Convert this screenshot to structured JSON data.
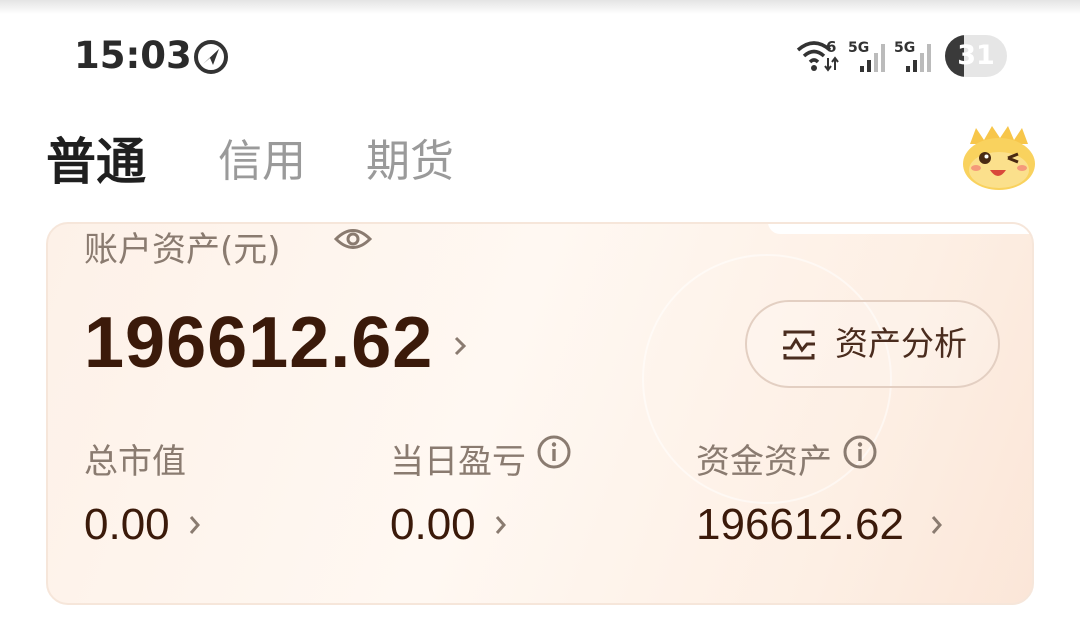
{
  "status_bar": {
    "time": "15:03",
    "wifi_label": "6",
    "signal_1_label": "5G",
    "signal_2_label": "5G",
    "battery": "31",
    "battery_level": 0.31
  },
  "tabs": [
    {
      "label": "普通",
      "active": true
    },
    {
      "label": "信用",
      "active": false
    },
    {
      "label": "期货",
      "active": false
    }
  ],
  "account": {
    "asset_label": "账户资产(元)",
    "total_assets": "196612.62",
    "analysis_button": "资产分析",
    "stats": [
      {
        "label": "总市值",
        "value": "0.00"
      },
      {
        "label": "当日盈亏",
        "value": "0.00"
      },
      {
        "label": "资金资产",
        "value": "196612.62"
      }
    ]
  },
  "colors": {
    "accent_text": "#3b1a0a",
    "muted_text": "#8a7b70",
    "card_bg": "#fdf1e8"
  },
  "icons": [
    "navigation-icon",
    "wifi-icon",
    "signal-icon",
    "eye-icon",
    "chart-analysis-icon",
    "info-icon",
    "chevron-right-icon",
    "mascot-avatar"
  ]
}
